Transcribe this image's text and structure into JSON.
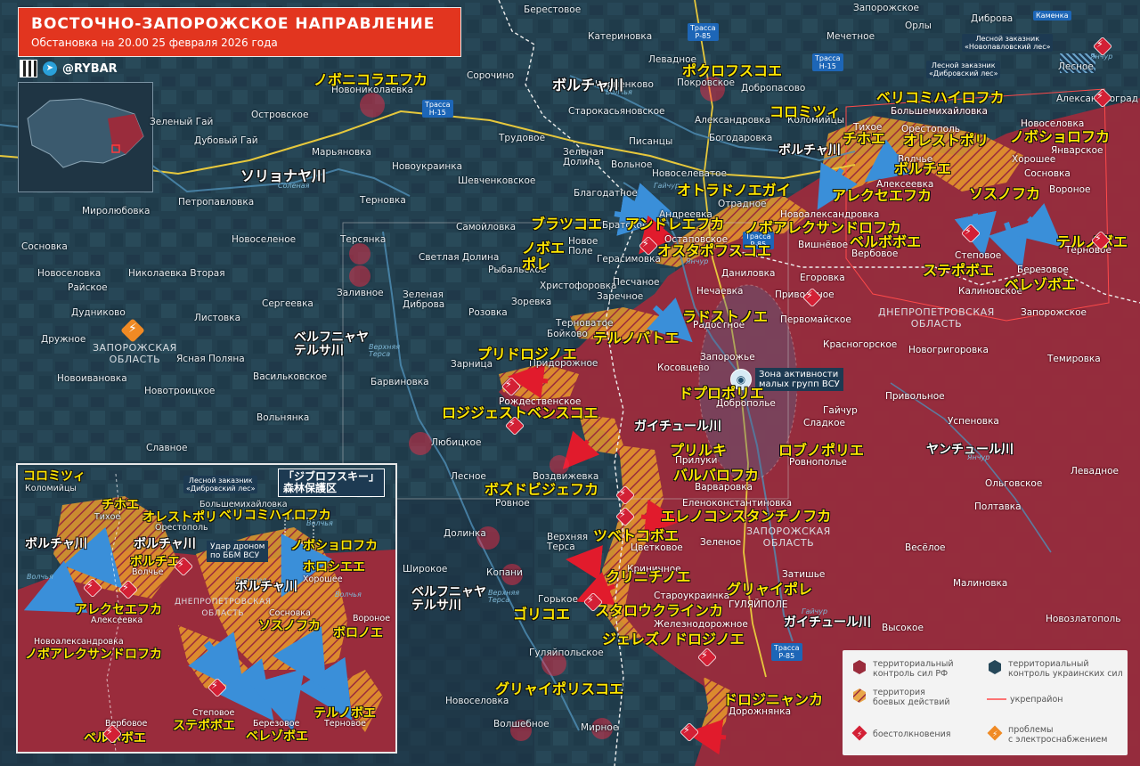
{
  "header": {
    "title": "ВОСТОЧНО-ЗАПОРОЖСКОЕ НАПРАВЛЕНИЕ",
    "subtitle": "Обстановка на 20.00 25 февраля 2026 года",
    "brand": "@RYBAR",
    "brand_icon": "telegram-icon",
    "qr_icon": "qr-code-icon"
  },
  "colors": {
    "russian_control": "#9a2c3c",
    "ukrainian_control": "#26485a",
    "contested": "#e89a2c",
    "clash_marker": "#d32035",
    "title_bg": "#e2351f",
    "japanese_label": "#ffe600",
    "arrow_ukr": "#3a8fd9",
    "arrow_ru": "#e11b2c"
  },
  "regions": {
    "zaporizhzhia_west": "ЗАПОРОЖСКАЯ\nОБЛАСТЬ",
    "zaporizhzhia_east": "ЗАПОРОЖСКАЯ\nОБЛАСТЬ",
    "dnipropetrovsk": "ДНЕПРОПЕТРОВСКАЯ\nОБЛАСТЬ"
  },
  "highways": {
    "r85_top": "Трасса\nР-85",
    "h15_top": "Трасса\nН-15",
    "h15_left": "Трасса\nН-15",
    "r85_mid": "Трасса\nР-85",
    "r85_bottom": "Трасса\nР-85"
  },
  "reserves": {
    "novopavlovsky": "Лесной заказник\n«Новопавловский лес»",
    "dibrovsky": "Лесной заказник\n«Дибровский лес»",
    "kamenka": "Каменка"
  },
  "rivers": {
    "volchya_1": "Волчья",
    "solenaya": "Соленая",
    "gaichur_1": "Гайчур",
    "yanchur_1": "Янчур",
    "yanchur_2": "Янчур",
    "verkhnyaya_tersa_1": "Верхняя\nТерса",
    "verkhnyaya_tersa_2": "Верхняя\nТерса",
    "gaichur_2": "Гайчур",
    "yanchur_3": "Янчур"
  },
  "zone_note": "Зона активности\nмалых групп ВСУ",
  "russian_towns": {
    "berestovoe": "Берестовое",
    "katerinovka": "Катериновка",
    "zaporozhskoe_top": "Запорожское",
    "dibrova": "Дибровa",
    "sorochino": "Сорочино",
    "levadnoe_top": "Левадное",
    "mechetnoe": "Мечетное",
    "orly": "Орлы",
    "novonikolaevka": "Новониколаевка",
    "chernenkovo": "Черненково",
    "pokrovskoe": "Покровское",
    "dobropasovo": "Добропасово",
    "lesnoe_top": "Лесное",
    "zelenyy_gai": "Зеленый Гай",
    "ostrovskoe": "Островское",
    "starokasyanovskoe": "Старокасьяновское",
    "aleksandrovka": "Александровка",
    "kolomiytsy": "Коломийцы",
    "bolshemikhaylovka": "Большемихайловка",
    "aleksandrograd": "Александроград",
    "dubovyy_gai": "Дубовый Гай",
    "trudovoe": "Трудовое",
    "pisantsy": "Писанцы",
    "bogodarovka": "Богодаровка",
    "tikhoe": "Тихое",
    "orestopol": "Орестополь",
    "novoselovka": "Новоселовка",
    "maryanovka": "Марьяновка",
    "zelenaya_dolina": "Зеленая\nДолина",
    "volnoe": "Вольное",
    "novoselevatoe": "Новоселеватое",
    "khoroshee": "Хорошее",
    "yanvarskoe": "Январское",
    "novoukrainka": "Новоукраинка",
    "shevchenkovskoe": "Шевченковское",
    "blagodatnoe": "Благодатное",
    "alekseevka": "Алексеевка",
    "volchye": "Волчье",
    "sosnovka": "Сосновка",
    "voronoe": "Вороное",
    "mirolyubovka": "Миролюбовка",
    "petropavlovka": "Петропавловка",
    "ternovka_mid": "Терновка",
    "andreevka": "Андреевка",
    "otradnoe": "Отрадное",
    "novoaleksandrovka": "Новоалександровка",
    "samoylovka": "Самойловка",
    "bratskoe": "Братское",
    "novoe_pole": "Новое\nПоле",
    "ostapovskoe": "Остаповское",
    "vishnevoe": "Вишнёвое",
    "verbovoe": "Вербовое",
    "stepovoe": "Степовое",
    "ternovoe": "Терновое",
    "sosnovka_w": "Сосновка",
    "novoselenoe": "Новоселеное",
    "tersyanka": "Терсянка",
    "svetlaya_dolina": "Светлая Долина",
    "gerasimovka": "Герасимовка",
    "danilovka": "Даниловка",
    "berezovoe": "Березовое",
    "egorovka": "Егоровка",
    "novoselovka_w": "Новоселовка",
    "novoivanovka_w": "Новоивановка",
    "zalivnoe": "Заливное",
    "rybalskoe": "Рыбальское",
    "kalinovskoe": "Калиновское",
    "novonikolaevka_vtoraya": "Николаевка Вторая",
    "raiskoe": "Райское",
    "peschanoe": "Песчаное",
    "nechaevka": "Нечаевка",
    "privolnoe_top": "Привольное",
    "khristoforovka": "Христофоровка",
    "sergeevka": "Сергеевка",
    "zelenaya_dibrova": "Зеленая\nДиброва",
    "zorevka": "Зоревка",
    "zarechnoe": "Заречное",
    "zaporozhskoe_e": "Запорожское",
    "dudnikovo": "Дудниково",
    "listovka": "Листовка",
    "rozovka": "Розовка",
    "ternovatoe": "Терноватое",
    "radostnoe": "Радостное",
    "pervomayskoe": "Первомайское",
    "druzhnoe": "Дружное",
    "boykovo": "Бойково",
    "krasnogorskoe": "Красногорское",
    "novogrigorovka": "Новогригоровка",
    "yasnaya_polyana": "Ясная Поляна",
    "temirovka": "Темировка",
    "zarnitsa": "Зарница",
    "pridorozhnoe": "Придорожное",
    "kosovtsevo": "Косовцево",
    "zaporozhye": "Запорожье",
    "vasilkovskoe": "Васильковское",
    "novoivanovka": "Новоивановка",
    "barvinovka": "Барвиновка",
    "rozhdestvenskoe": "Рождественское",
    "dobropolye": "Доброполье",
    "privolnoe": "Привольное",
    "novotroitskoe": "Новотроицкое",
    "gaichur_town": "Гайчур",
    "uspenovka": "Успеновка",
    "volnyanka": "Вольнянка",
    "sladkoe": "Сладкое",
    "lyubitskoe": "Любицкое",
    "pryluki": "Прилуки",
    "rovnopolye": "Ровнополье",
    "slavnoe": "Славное",
    "levadnoe": "Левадное",
    "lesnoe": "Лесное",
    "varvarovka": "Варваровка",
    "olgovskoe": "Ольговское",
    "vozdvizhevka": "Воздвижевка",
    "elenokonstantinovka": "Еленоконстантиновка",
    "rovnoe": "Ровное",
    "poltavka": "Полтавка",
    "dolinka": "Долинка",
    "verkhnyaya_tersa": "Верхняя\nТерса",
    "tsvetkovoe": "Цветковое",
    "zelenoe": "Зеленое",
    "veseloe": "Весёлое",
    "shirokoe": "Широкое",
    "kopani": "Копани",
    "krinichnoe": "Криничное",
    "zatishye": "Затишье",
    "malinovka": "Малиновка",
    "gorkoe": "Горькое",
    "staroukrainka": "Староукраинка",
    "gulyaypole": "ГУЛЯЙПОЛЕ",
    "zheleznodorozhnoe": "Железнодорожное",
    "novozlatopol": "Новозлатополь",
    "vysokoe": "Высокое",
    "gulyaypolskoe": "Гуляйпольское",
    "novoselovka_s": "Новоселовка",
    "dorozhnyanka": "Дорожнянка",
    "volshebnoe": "Волшебное",
    "mirnoe": "Мирное"
  },
  "jp_labels": {
    "novonikolaevka": "ノボニコラエフカ",
    "pokrovskoe": "ポクロフスコエ",
    "volchya_river": "ボルチャ川",
    "kolomiytsy": "コロミツィ",
    "volchya_river_2": "ボルチャ川",
    "velikomikhaylovka": "ベリコミハイロフカ",
    "tikhoe": "チホエ",
    "orestopol": "オレストポリ",
    "novoselovka": "ノボショロフカ",
    "volchye": "ボルチエ",
    "solenaya_river": "ソリョナヤ川",
    "alekseevka": "アレクセエフカ",
    "sosnovka": "ソスノフカ",
    "otradnoe": "オトラドノエガイ",
    "andreevka": "アンドレエフカ",
    "bratskoe": "ブラツコエ",
    "novoaleksandrovka": "ノボアレクサンドロフカ",
    "verbovoe": "ベルボボエ",
    "ternovoe": "テルノボエ",
    "novoe_pole": "ノボエ\nポレ",
    "ostapovskoe": "オスタポフスコエ",
    "stepovoe": "ステポボエ",
    "berezovoe": "ベレゾボエ",
    "radostnoe": "ラドストノエ",
    "ternovatoe": "テルノバトエ",
    "verkhnyaya_tersa_river": "ベルフニャヤ\nテルサ川",
    "pridorozhnoe": "プリドロジノエ",
    "dobropolye": "ドプロポリエ",
    "rozhdestvenskoe": "ロジジェストベンスコエ",
    "gaichur_river": "ガイチュール川",
    "pryluki": "プリルキ",
    "varvarovka": "バルバロフカ",
    "rovnopolye": "ロブノポリエ",
    "yanchur_river": "ヤンチュール川",
    "vozdvizhevka": "ボズドビジェフカ",
    "elenokonstantinovka": "エレノコンスタンチノフカ",
    "tsvetkovoe": "ツベトコボエ",
    "krinichnoe": "クリニチノエ",
    "gulyaypole": "グリャイポレ",
    "verkhnyaya_tersa_river_2": "ベルフニャヤ\nテルサ川",
    "gorkoe": "ゴリコエ",
    "staroukrainka": "スタロウクラインカ",
    "gaichur_river_2": "ガイチュール川",
    "zheleznodorozhnoe": "ジェレズノドロジノエ",
    "gulyaypolskoe": "グリャイポリスコエ",
    "dorozhnyanka": "ドロジニャンカ"
  },
  "inset": {
    "badge": "「ジブロフスキー」\n森林保護区",
    "reserve": "Лесной заказник\n«Дибровский лес»",
    "callout": "Удар дроном\nпо ББМ ВСУ",
    "region": "ДНЕПРОПЕТРОВСКАЯ\nОБЛАСТЬ",
    "river_volchya_1": "Волчья",
    "river_volchya_2": "Волчья",
    "river_volchya_3": "Волчья",
    "river_voronaya": "Вороная",
    "towns": {
      "kolomiytsy": "Коломийцы",
      "bolshemikhaylovka": "Большемихайловка",
      "tikhoe": "Тихое",
      "orestopol": "Орестополь",
      "volchye": "Волчье",
      "khoroshee": "Хорошее",
      "alekseevka": "Алексеевка",
      "novoaleksandrovka": "Новоалександровка",
      "sosnovka": "Сосновка",
      "voronoe": "Вороное",
      "verbovoe": "Вербовое",
      "stepovoe": "Степовое",
      "berezovoe": "Березовое",
      "ternovoe": "Терновое"
    },
    "jp": {
      "kolomiytsy": "コロミツィ",
      "tikhoe": "チホエ",
      "orestopol": "オレストポリ",
      "velikomikhaylovka": "ベリコミハイロフカ",
      "volchya_river": "ボルチャ川",
      "volchya_river_2": "ボルチャ川",
      "volchye": "ボルチエ",
      "novoselovka": "ノボショロフカ",
      "khoroshee": "ホロシエエ",
      "volchya_river_3": "ボルチャ川",
      "alekseevka": "アレクセエフカ",
      "sosnovka": "ソスノフカ",
      "voronoe": "ボロノエ",
      "novoaleksandrovka": "ノボアレクサンドロフカ",
      "ternovoe": "テルノボエ",
      "verbovoe": "ベルボボエ",
      "stepovoe": "ステポボエ",
      "berezovoe": "ベレゾボエ"
    }
  },
  "legend": {
    "ru_control": "территориальный\nконтроль сил РФ",
    "ukr_control": "территориальный\nконтроль украинских сил",
    "contested": "территория\nбоевых действий",
    "fortification": "укрепрайон",
    "clashes": "боестолкновения",
    "power_problems": "проблемы\nс электроснабжением",
    "icons": {
      "ru_control": "red-hexagon-icon",
      "ukr_control": "blue-hexagon-icon",
      "contested": "hatched-hexagon-icon",
      "fortification": "line-icon",
      "clashes": "clash-icon",
      "power_problems": "power-outage-icon"
    }
  }
}
